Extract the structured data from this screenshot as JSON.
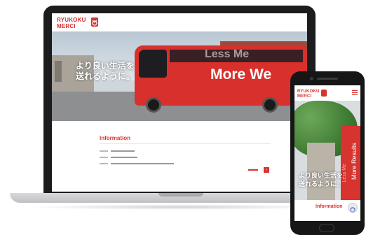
{
  "brand": {
    "logo_line1": "RYUKOKU",
    "logo_line2": "MERCI",
    "accent_color": "#d7332f"
  },
  "laptop": {
    "nav": [
      "",
      "",
      "",
      "",
      "",
      "",
      "",
      ""
    ],
    "hero": {
      "headline_line1": "より良い生活を",
      "headline_line2": "送れるように。",
      "bus_text_1": "Less Me",
      "bus_text_2": "More We"
    },
    "info": {
      "title": "Information",
      "rows": [
        {
          "date": "",
          "text": ""
        },
        {
          "date": "",
          "text": ""
        },
        {
          "date": "",
          "text": ""
        }
      ],
      "more_label": "",
      "more_arrow": "›"
    }
  },
  "phone": {
    "logo_line1": "RYUKOKU",
    "logo_line2": "MERCI",
    "banner_text_1": "More Results",
    "banner_text_2": "Less Me",
    "headline_line1": "より良い生活を",
    "headline_line2": "送れるように。",
    "info_title": "Information",
    "icons": {
      "menu": "menu-icon",
      "recaptcha": "recaptcha-icon"
    }
  }
}
